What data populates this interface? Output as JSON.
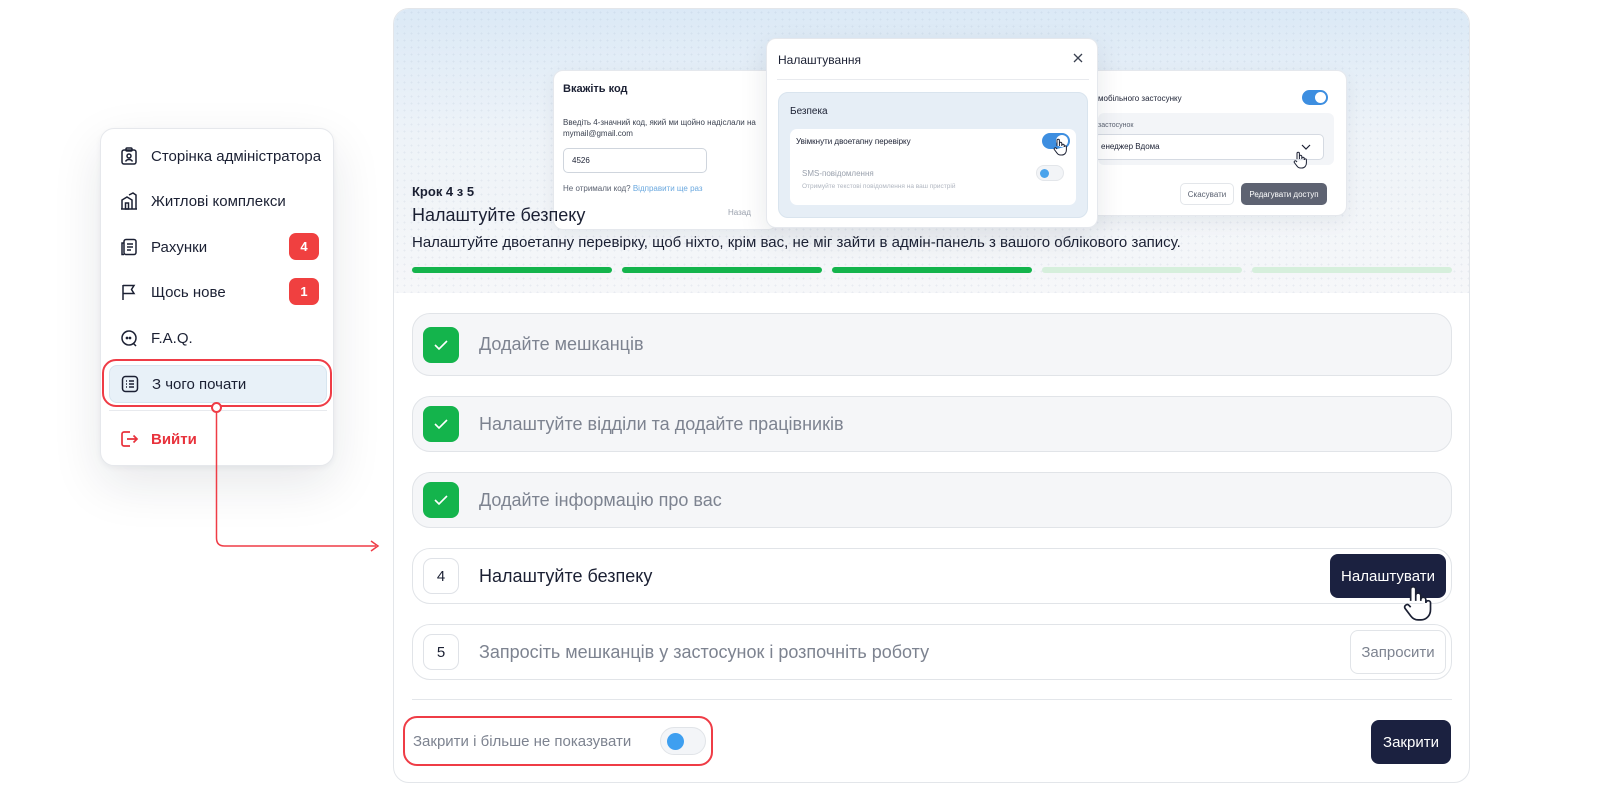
{
  "sidebar": {
    "items": [
      {
        "label": "Сторінка адміністратора",
        "icon": "admin-badge-icon"
      },
      {
        "label": "Житлові комплекси",
        "icon": "buildings-icon"
      },
      {
        "label": "Рахунки",
        "icon": "invoice-icon",
        "badge": "4"
      },
      {
        "label": "Щось нове",
        "icon": "flag-icon",
        "badge": "1"
      },
      {
        "label": "F.A.Q.",
        "icon": "chat-bubble-icon"
      },
      {
        "label": "З чого почати",
        "icon": "checklist-icon",
        "active": true
      }
    ],
    "logout_label": "Вийти",
    "badge_color": "#f04040",
    "logout_color": "#e8323c"
  },
  "preview": {
    "code_card": {
      "title": "Вкажіть код",
      "description": "Введіть 4-значний код, який ми щойно надіслали на mymail@gmail.com",
      "code_value": "4526",
      "resend_question": "Не отримали код?",
      "resend_link": "Відправити ще раз",
      "back_label": "Назад"
    },
    "settings_modal": {
      "title": "Налаштування",
      "section_title": "Безпека",
      "two_factor_label": "Увімкнути двоетапну перевірку",
      "sms_label": "SMS-повідомлення",
      "sms_description": "Отримуйте текстові повідомлення на ваш пристрій"
    },
    "access_card": {
      "mobile_label": "мобільного застосунку",
      "app_label": "застосунок",
      "app_value": "енеджер Вдома",
      "cancel_label": "Скасувати",
      "edit_label": "Редагувати доступ"
    }
  },
  "step": {
    "counter": "Крок 4 з 5",
    "title": "Налаштуйте безпеку",
    "description": "Налаштуйте двоетапну перевірку, щоб ніхто, крім вас, не міг зайти в адмін-панель з вашого облікового запису.",
    "progress_done": 3,
    "progress_total": 5,
    "progress_color": "#14b44c",
    "progress_pending_color": "#d6efdc"
  },
  "tasks": [
    {
      "label": "Додайте мешканців",
      "status": "done"
    },
    {
      "label": "Налаштуйте відділи та додайте працівників",
      "status": "done"
    },
    {
      "label": "Додайте інформацію про вас",
      "status": "done"
    },
    {
      "number": "4",
      "label": "Налаштуйте безпеку",
      "status": "current",
      "action": "Налаштувати"
    },
    {
      "number": "5",
      "label": "Запросіть мешканців у застосунок і розпочніть роботу",
      "status": "pending",
      "action": "Запросити"
    }
  ],
  "footer": {
    "hide_label": "Закрити і більше не показувати",
    "close_label": "Закрити"
  },
  "accent": {
    "highlight": "#ef3c46",
    "dark_button": "#1b2140",
    "toggle_blue": "#3e9ff0"
  }
}
